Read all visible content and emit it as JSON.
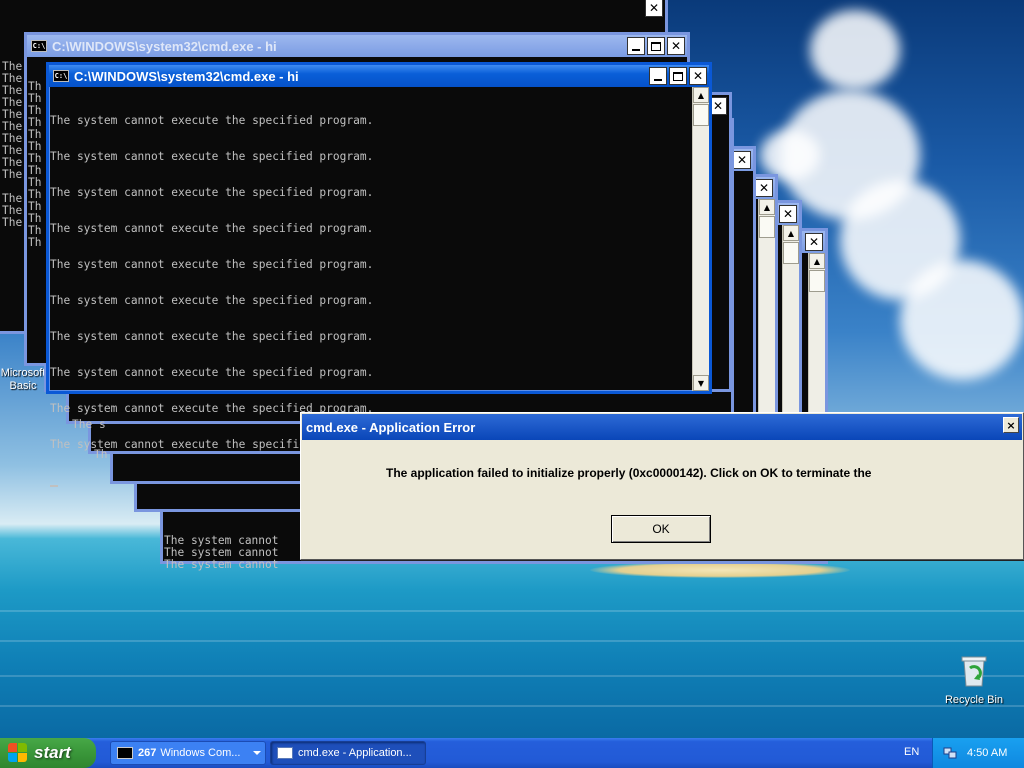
{
  "cmd_window_title": "C:\\WINDOWS\\system32\\cmd.exe - hi",
  "cmd_error_line": "The system cannot execute the specified program.",
  "cmd_lines": [
    "The system cannot execute the specified program.",
    "The system cannot execute the specified program.",
    "The system cannot execute the specified program.",
    "The system cannot execute the specified program.",
    "The system cannot execute the specified program.",
    "The system cannot execute the specified program.",
    "The system cannot execute the specified program.",
    "The system cannot execute the specified program.",
    "The system cannot execute the specified program.",
    "The system cannot execute the specified program."
  ],
  "cmd_fragments": {
    "the": "The",
    "the_s": "The s",
    "the_short": "Th",
    "cannot": "The system cannot"
  },
  "desktop": {
    "ms_label_1": "Microsoft",
    "ms_label_2": "Basic",
    "recycle_bin": "Recycle Bin"
  },
  "dialog": {
    "title": "cmd.exe - Application Error",
    "message": "The application failed to initialize properly (0xc0000142). Click on OK to terminate the",
    "ok_label": "OK",
    "close_label": "×"
  },
  "taskbar": {
    "start_label": "start",
    "group_count": "267",
    "group_label": "Windows Com...",
    "active_label": "cmd.exe - Application...",
    "language": "EN",
    "clock": "4:50 AM"
  },
  "colors": {
    "titlebar_active": "#0a5fd8",
    "console_bg": "#0a0a0a",
    "console_text": "#c0c0c0",
    "dialog_bg": "#ece9d8",
    "taskbar": "#245edb",
    "start_green": "#3c9a3c"
  },
  "icons": {
    "console": "cmd-icon",
    "minimize": "minimize-icon",
    "maximize": "maximize-icon",
    "close": "close-icon",
    "recycle": "recycle-bin-icon",
    "windows": "windows-logo-icon",
    "tray": "network-icon"
  }
}
